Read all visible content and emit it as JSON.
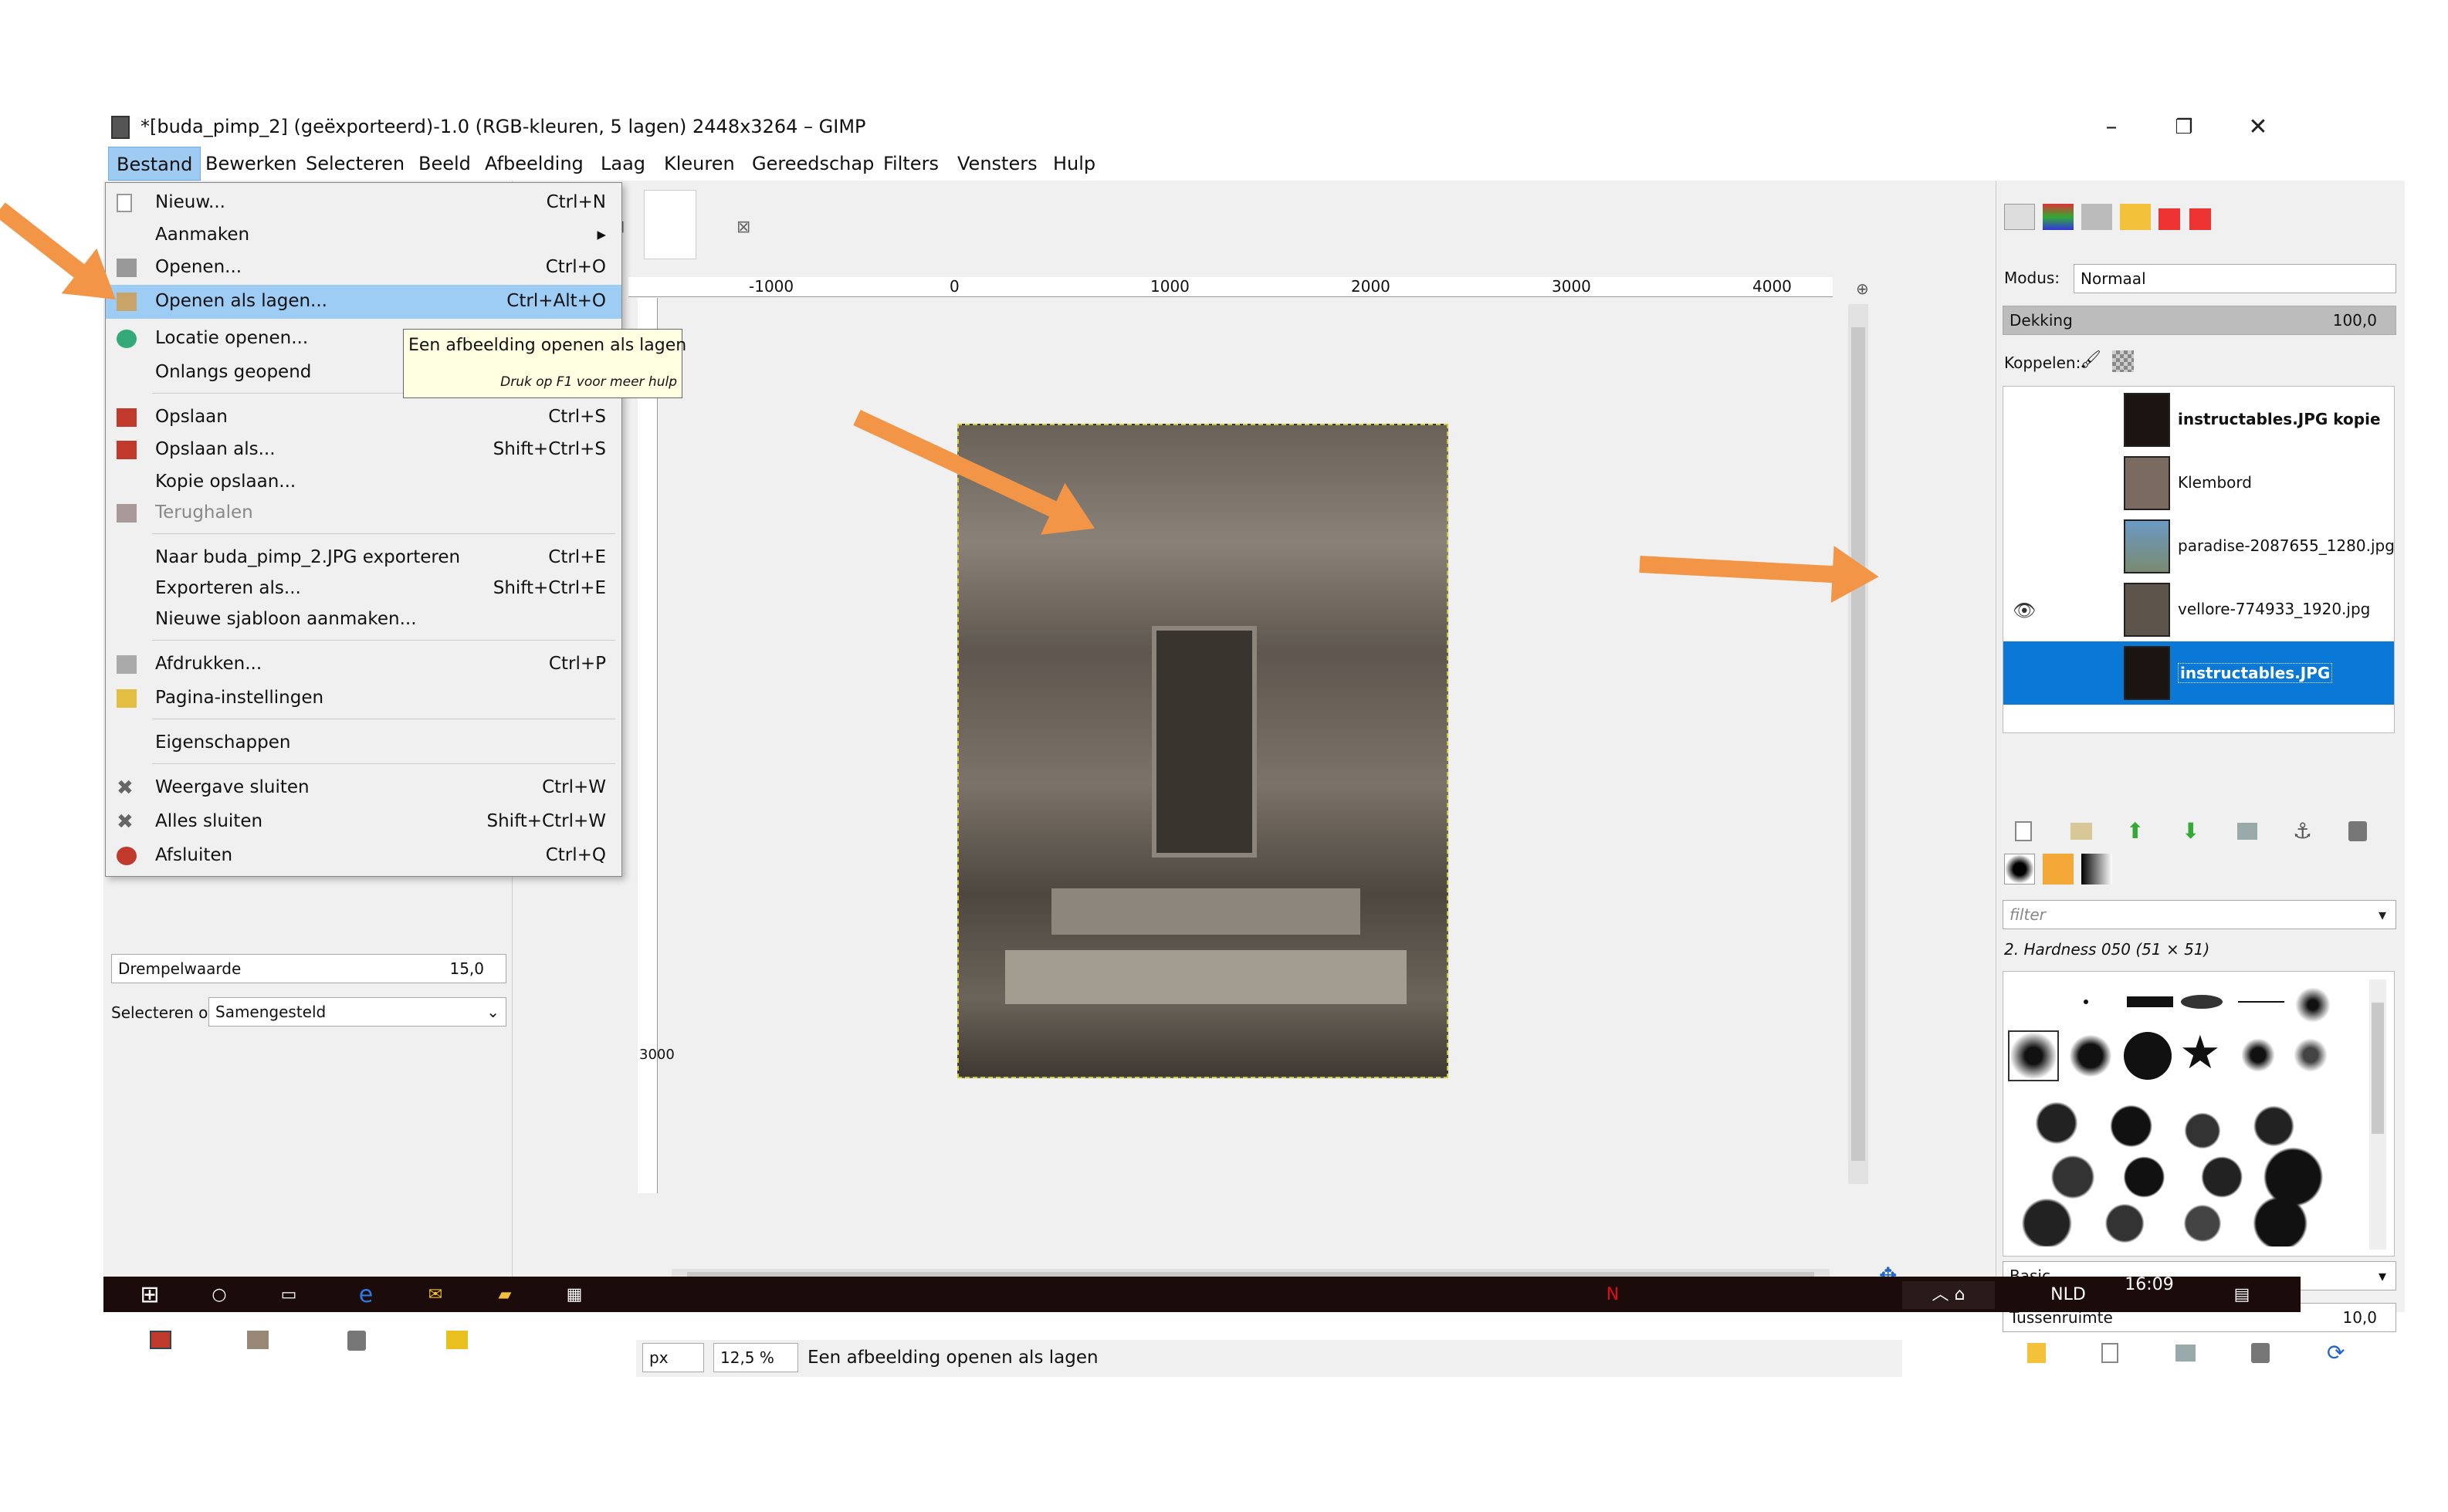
{
  "window": {
    "title": "*[buda_pimp_2] (geëxporteerd)-1.0 (RGB-kleuren, 5 lagen) 2448x3264 – GIMP",
    "min": "–",
    "restore": "❐",
    "close": "✕"
  },
  "menubar": [
    "Bestand",
    "Bewerken",
    "Selecteren",
    "Beeld",
    "Afbeelding",
    "Laag",
    "Kleuren",
    "Gereedschap",
    "Filters",
    "Vensters",
    "Hulp"
  ],
  "file_menu": [
    {
      "label": "Nieuw...",
      "shortcut": "Ctrl+N"
    },
    {
      "label": "Aanmaken",
      "shortcut": "▸"
    },
    {
      "label": "Openen...",
      "shortcut": "Ctrl+O"
    },
    {
      "label": "Openen als lagen...",
      "shortcut": "Ctrl+Alt+O"
    },
    {
      "label": "Locatie openen...",
      "shortcut": ""
    },
    {
      "label": "Onlangs geopend",
      "shortcut": ""
    },
    {
      "label": "Opslaan",
      "shortcut": "Ctrl+S"
    },
    {
      "label": "Opslaan als...",
      "shortcut": "Shift+Ctrl+S"
    },
    {
      "label": "Kopie opslaan...",
      "shortcut": ""
    },
    {
      "label": "Terughalen",
      "shortcut": ""
    },
    {
      "label": "Naar buda_pimp_2.JPG exporteren",
      "shortcut": "Ctrl+E"
    },
    {
      "label": "Exporteren als...",
      "shortcut": "Shift+Ctrl+E"
    },
    {
      "label": "Nieuwe sjabloon aanmaken...",
      "shortcut": ""
    },
    {
      "label": "Afdrukken...",
      "shortcut": "Ctrl+P"
    },
    {
      "label": "Pagina-instellingen",
      "shortcut": ""
    },
    {
      "label": "Eigenschappen",
      "shortcut": ""
    },
    {
      "label": "Weergave sluiten",
      "shortcut": "Ctrl+W"
    },
    {
      "label": "Alles sluiten",
      "shortcut": "Shift+Ctrl+W"
    },
    {
      "label": "Afsluiten",
      "shortcut": "Ctrl+Q"
    }
  ],
  "tooltip": {
    "main": "Een afbeelding openen als lagen",
    "hint": "Druk op F1 voor meer hulp"
  },
  "toolbox": {
    "threshold_label": "Drempelwaarde",
    "threshold_value": "15,0",
    "select_by_label": "Selecteren op:",
    "select_by_value": "Samengesteld"
  },
  "ruler": {
    "ticks": [
      "-1000",
      "0",
      "1000",
      "2000",
      "3000",
      "4000"
    ],
    "left": "3000"
  },
  "statusbar": {
    "unit": "px",
    "zoom": "12,5 %",
    "message": "Een afbeelding openen als lagen"
  },
  "layers_panel": {
    "mode_label": "Modus:",
    "mode_value": "Normaal",
    "opacity_label": "Dekking",
    "opacity_value": "100,0",
    "lock_label": "Koppelen:",
    "layers": [
      {
        "name": "instructables.JPG kopie",
        "bold": true
      },
      {
        "name": "Klembord",
        "bold": false
      },
      {
        "name": "paradise-2087655_1280.jpg",
        "bold": false
      },
      {
        "name": "vellore-774933_1920.jpg",
        "bold": false
      },
      {
        "name": "instructables.JPG",
        "bold": true
      }
    ]
  },
  "brushes_panel": {
    "filter_placeholder": "filter",
    "brush_name": "2. Hardness 050 (51 × 51)",
    "preset": "Basic,",
    "spacing_label": "Tussenruimte",
    "spacing_value": "10,0"
  },
  "taskbar": {
    "time": "16:09",
    "lang": "NLD"
  }
}
